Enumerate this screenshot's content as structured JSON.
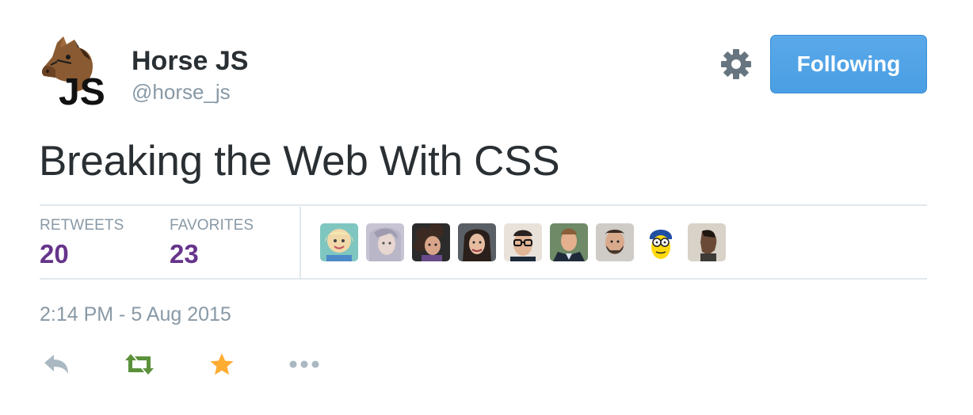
{
  "author": {
    "name": "Horse JS",
    "handle": "@horse_js",
    "avatar_icon": "horse-head-js-logo",
    "avatar_text": "JS"
  },
  "header": {
    "settings_icon": "gear-icon",
    "follow_label": "Following",
    "follow_color": "#55acee"
  },
  "tweet": {
    "text": "Breaking the Web With CSS",
    "timestamp": "2:14 PM - 5 Aug 2015"
  },
  "stats": {
    "retweets_label": "RETWEETS",
    "retweets_count": "20",
    "favorites_label": "FAVORITES",
    "favorites_count": "23",
    "count_color": "#66348b"
  },
  "favoriters": [
    {
      "avatar": "user-avatar-blonde-woman"
    },
    {
      "avatar": "user-avatar-gray-haired-woman"
    },
    {
      "avatar": "user-avatar-curly-haired-woman"
    },
    {
      "avatar": "user-avatar-dark-haired-woman"
    },
    {
      "avatar": "user-avatar-man-with-glasses"
    },
    {
      "avatar": "user-avatar-man-in-suit"
    },
    {
      "avatar": "user-avatar-bearded-man"
    },
    {
      "avatar": "user-avatar-cartoon-character"
    },
    {
      "avatar": "user-avatar-man-profile"
    }
  ],
  "actions": {
    "reply_icon": "reply-icon",
    "retweet_icon": "retweet-icon",
    "retweet_color": "#5c913b",
    "favorite_icon": "star-icon",
    "favorite_color": "#ffac33",
    "more_icon": "more-dots-icon"
  }
}
